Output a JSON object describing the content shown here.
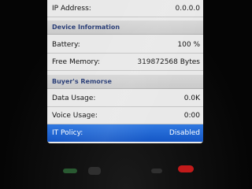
{
  "rows": {
    "ip_address": {
      "label": "IP Address:",
      "value": "0.0.0.0"
    },
    "battery": {
      "label": "Battery:",
      "value": "100 %"
    },
    "free_memory": {
      "label": "Free Memory:",
      "value": "319872568 Bytes"
    },
    "data_usage": {
      "label": "Data Usage:",
      "value": "0.0K"
    },
    "voice_usage": {
      "label": "Voice Usage:",
      "value": "0:00"
    },
    "it_policy": {
      "label": "IT Policy:",
      "value": "Disabled"
    }
  },
  "sections": {
    "device_information": "Device Information",
    "buyers_remorse": "Buyer's Remorse"
  },
  "colors": {
    "selection": "#1f66d6",
    "section_header_text": "#2b3f78",
    "screen_bg": "#e9e9e9",
    "end_key": "#c21a1a",
    "call_key": "#2f6b3a"
  },
  "hardware_keys": [
    "call-key-icon",
    "menu-key-icon",
    "back-key-icon",
    "end-key-icon"
  ]
}
